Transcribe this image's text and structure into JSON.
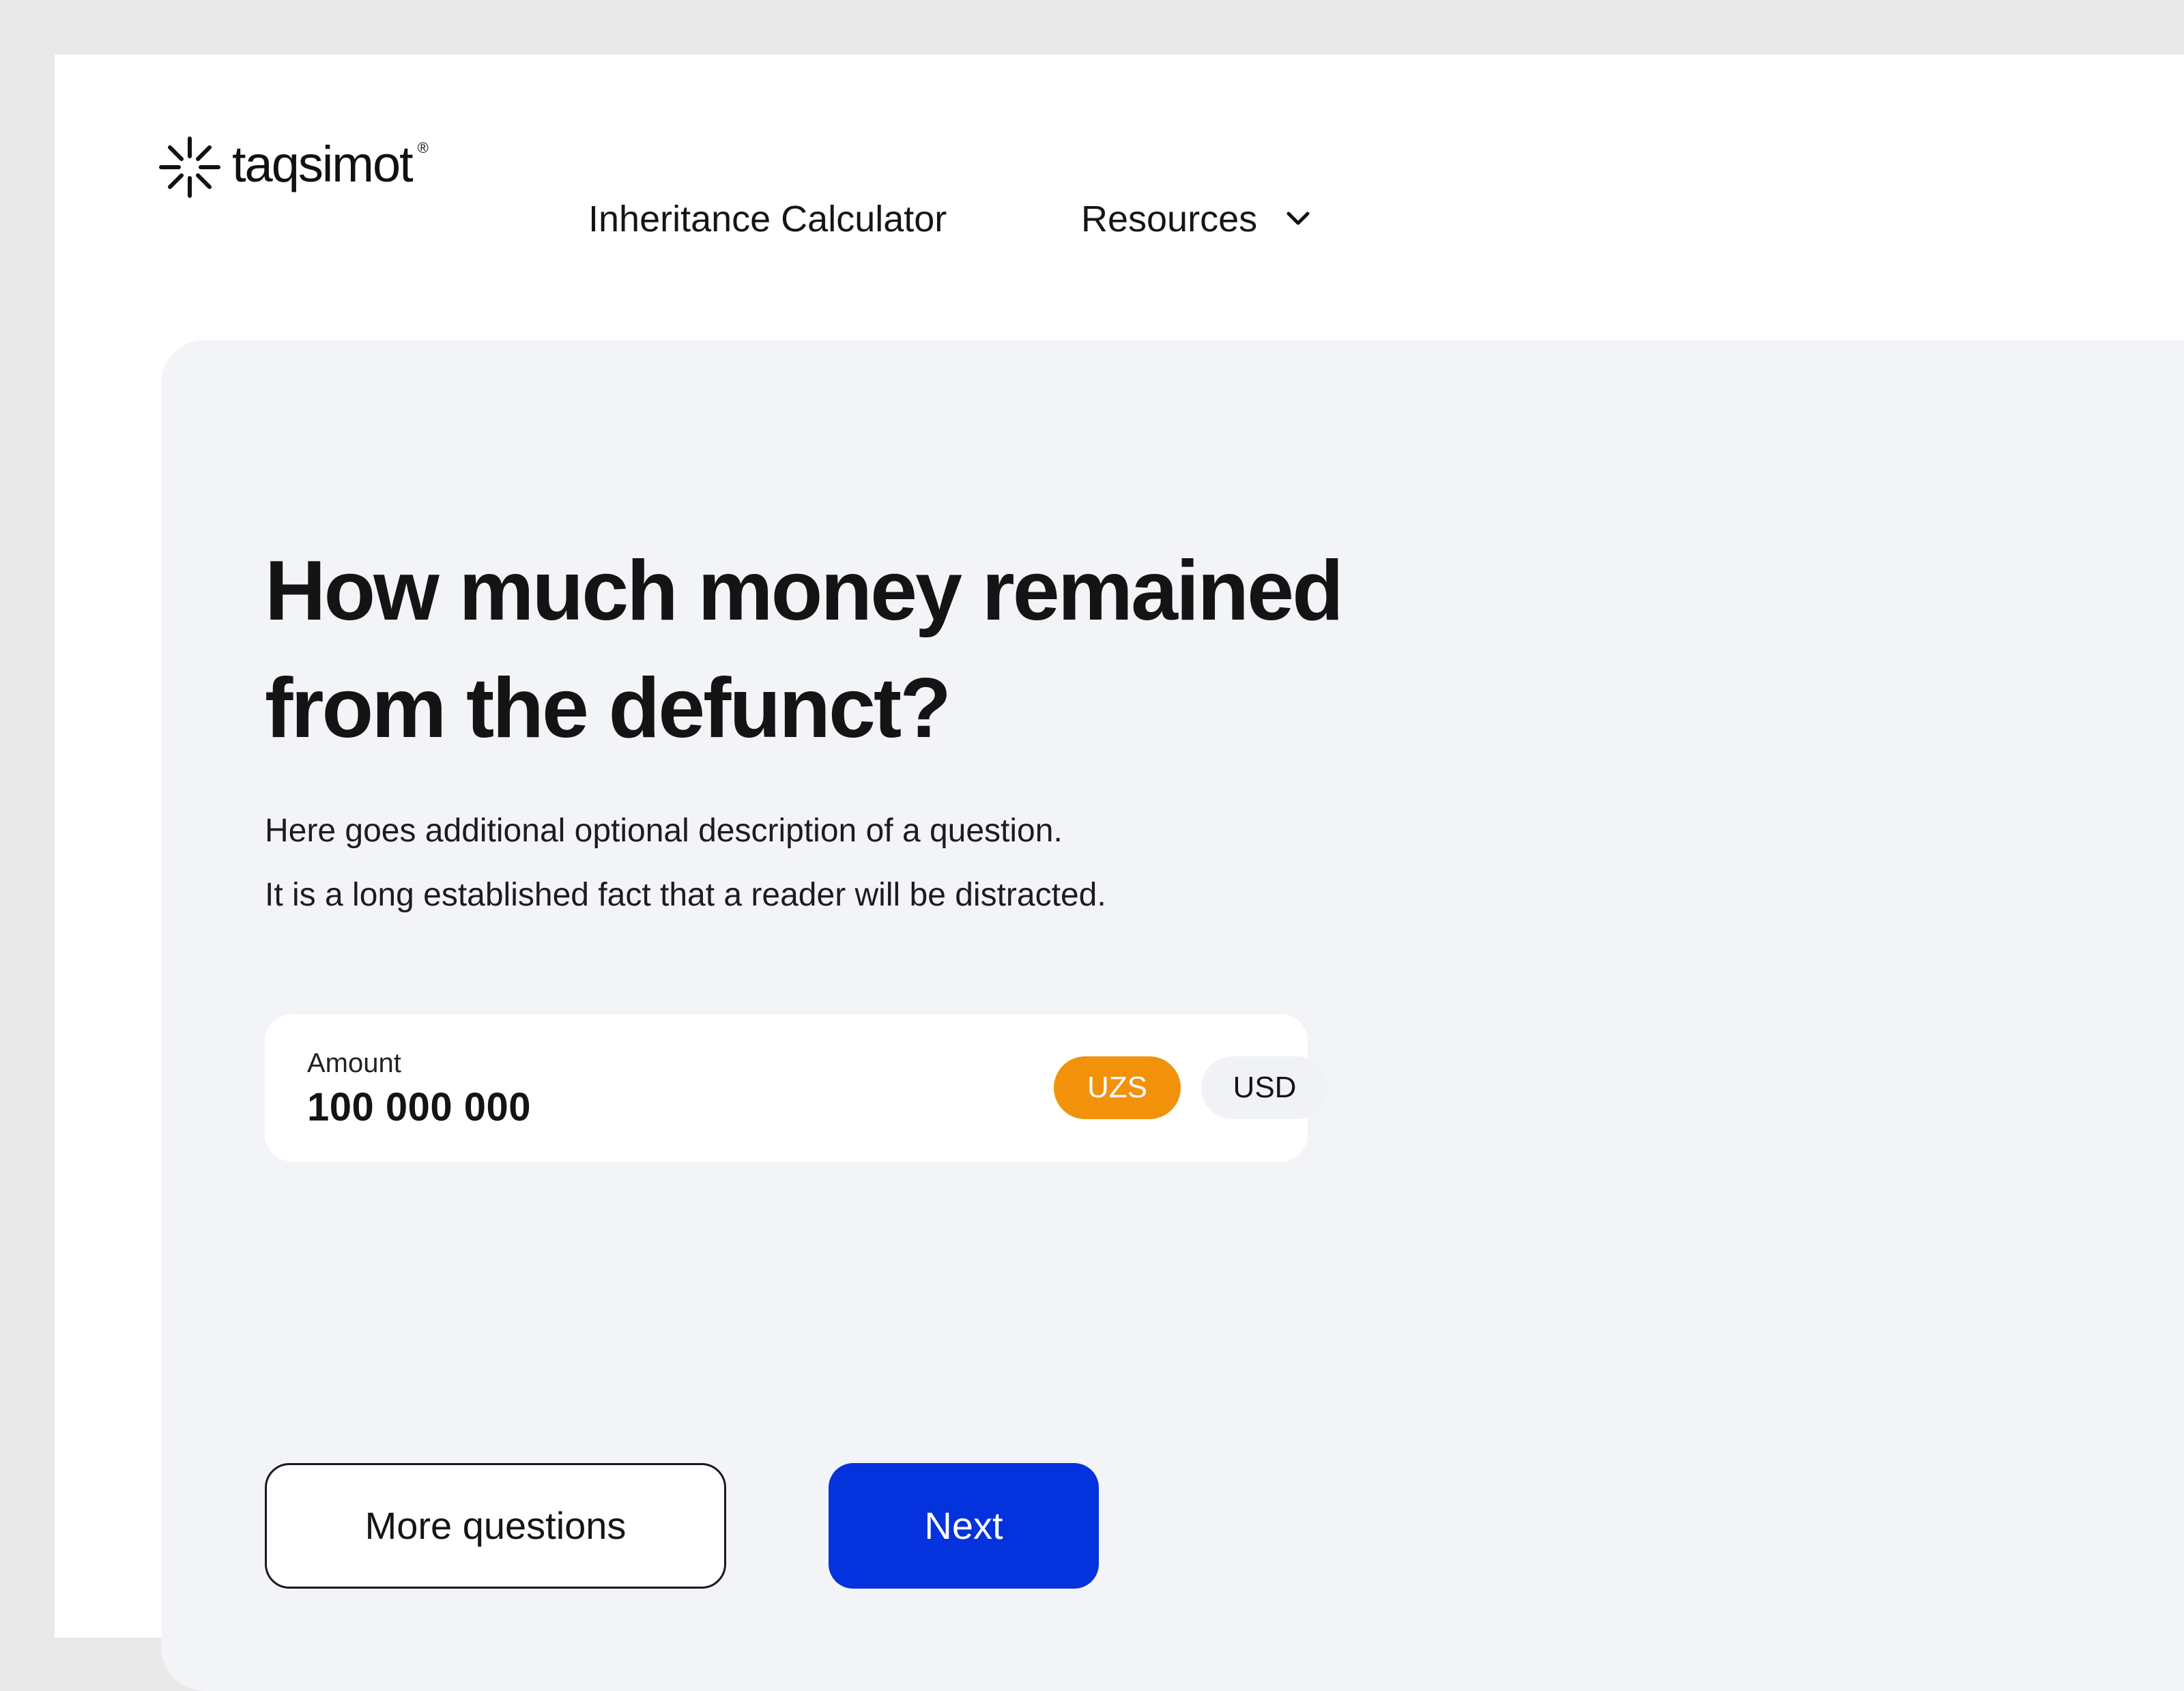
{
  "header": {
    "logo_text": "taqsimot",
    "logo_reg": "®",
    "nav": {
      "calculator": "Inheritance Calculator",
      "resources": "Resources"
    }
  },
  "question": {
    "title": "How much money remained from the defunct?",
    "description_lines": [
      "Here goes additional optional description of a question.",
      "It is a long established fact that a reader will be distracted."
    ]
  },
  "amount": {
    "label": "Amount",
    "value": "100 000 000",
    "currencies": [
      "UZS",
      "USD"
    ],
    "selected_currency": "UZS"
  },
  "actions": {
    "more_label": "More questions",
    "next_label": "Next"
  },
  "colors": {
    "accent_orange": "#F2920B",
    "primary_blue": "#0432DC",
    "card_bg": "#F3F4F8"
  },
  "icons": {
    "logo": "sunburst-logo-icon",
    "dropdown": "chevron-down-icon"
  }
}
